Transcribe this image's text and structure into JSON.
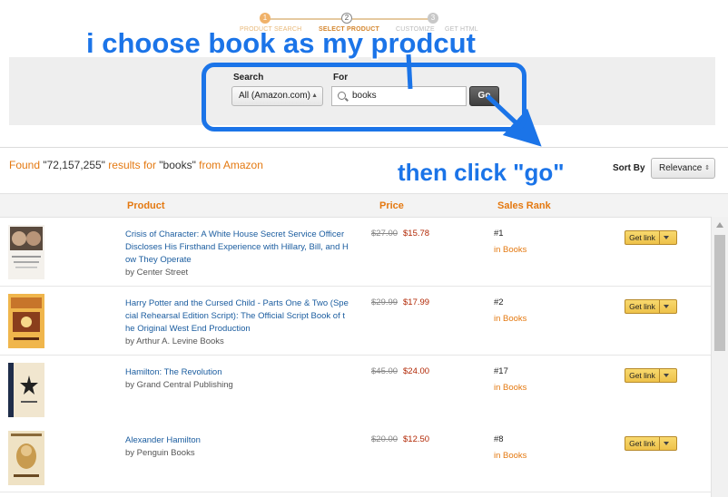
{
  "wizard": {
    "steps": [
      {
        "num": "1",
        "label": "PRODUCT SEARCH"
      },
      {
        "num": "2",
        "label": "SELECT PRODUCT"
      },
      {
        "num": "3",
        "label": "CUSTOMIZE"
      },
      {
        "num": "",
        "label": "GET HTML"
      }
    ]
  },
  "search": {
    "search_label": "Search",
    "for_label": "For",
    "category": "All (Amazon.com)",
    "query": "books",
    "go_label": "Go"
  },
  "results": {
    "found_prefix": "Found ",
    "count": "\"72,157,255\"",
    "results_for": " results for ",
    "query": "\"books\"",
    "from": " from Amazon",
    "sort_label": "Sort By",
    "sort_value": "Relevance"
  },
  "columns": {
    "product": "Product",
    "price": "Price",
    "sales_rank": "Sales Rank"
  },
  "rows": [
    {
      "title": "Crisis of Character: A White House Secret Service Officer Discloses His Firsthand Experience with Hillary, Bill, and H ow They Operate",
      "by": "by Center Street",
      "old_price": "$27.00",
      "price": "$15.78",
      "rank": "#1",
      "in": "in Books",
      "get_link": "Get link",
      "cover_text": "CRISIS OF CHARACTER"
    },
    {
      "title": "Harry Potter and the Cursed Child - Parts One & Two (Spe cial Rehearsal Edition Script): The Official Script Book of t he Original West End Production",
      "by": "by Arthur A. Levine Books",
      "old_price": "$29.99",
      "price": "$17.99",
      "rank": "#2",
      "in": "in Books",
      "get_link": "Get link",
      "cover_text": "HARRY POTTER"
    },
    {
      "title": "Hamilton: The Revolution",
      "by": "by Grand Central Publishing",
      "old_price": "$45.00",
      "price": "$24.00",
      "rank": "#17",
      "in": "in Books",
      "get_link": "Get link",
      "cover_text": "HAMILTON"
    },
    {
      "title": "Alexander Hamilton",
      "by": "by Penguin Books",
      "old_price": "$20.00",
      "price": "$12.50",
      "rank": "#8",
      "in": "in Books",
      "get_link": "Get link",
      "cover_text": "HAMILTON"
    }
  ],
  "annotations": {
    "top": "i choose book as my prodcut",
    "bottom": "then click \"go\""
  },
  "colors": {
    "accent": "#e47911",
    "annotation": "#1b74e8",
    "link": "#1a5c9f",
    "price": "#b12704"
  }
}
